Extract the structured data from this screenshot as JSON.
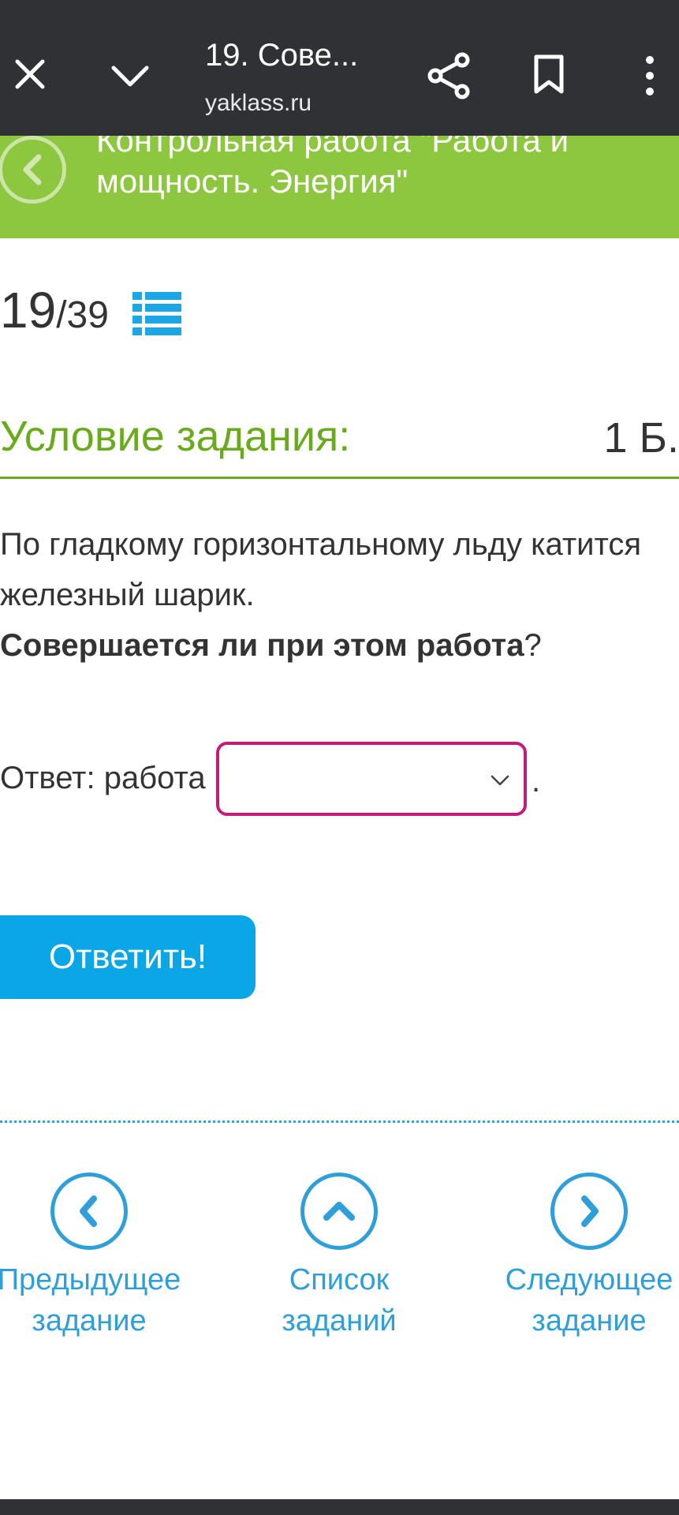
{
  "browser": {
    "tab_title": "19. Сове...",
    "url": "yaklass.ru",
    "icons": [
      "close-icon",
      "chevron-down-icon",
      "share-icon",
      "bookmark-icon",
      "more-vertical-icon"
    ]
  },
  "header": {
    "title": "Контрольная работа \"Работа и мощность. Энергия\"",
    "back_icon": "chevron-left-icon",
    "bg_color": "#8dc63f"
  },
  "counter": {
    "current": "19",
    "total": "/39"
  },
  "condition": {
    "title": "Условие задания:",
    "points": "1 Б."
  },
  "question": {
    "line1": "По гладкому горизонтальному льду катится железный шарик.",
    "bold": "Совершается ли при этом работа",
    "end": "?"
  },
  "answer": {
    "label": "Ответ: работа",
    "selected_value": "",
    "after": "."
  },
  "submit": {
    "label": "Ответить!"
  },
  "nav": {
    "prev": {
      "line1": "Предыдущее",
      "line2": "задание"
    },
    "list": {
      "line1": "Список",
      "line2": "заданий"
    },
    "next": {
      "line1": "Следующее",
      "line2": "задание"
    }
  },
  "colors": {
    "browser_bar": "#303134",
    "accent_green": "#6aab1c",
    "header_green": "#8dc63f",
    "button_blue": "#0aa6e6",
    "link_blue": "#2e9fd8",
    "select_border": "#c51a7a"
  }
}
